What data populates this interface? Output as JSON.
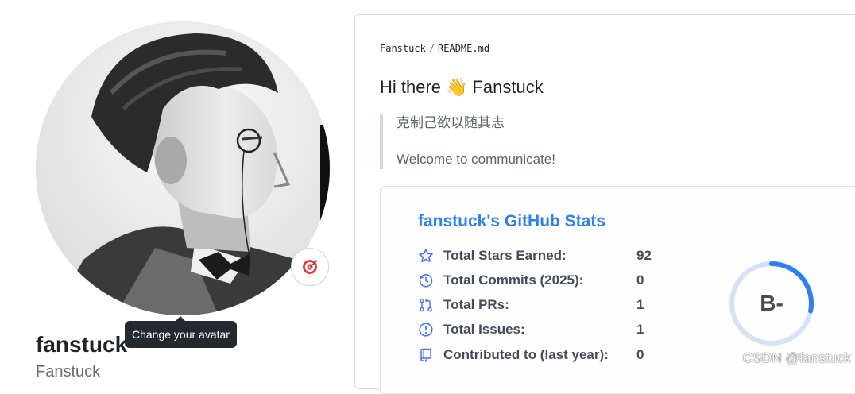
{
  "profile": {
    "name": "fanstuck",
    "login": "Fanstuck",
    "avatar_tooltip": "Change your avatar",
    "status_icon": "target-emoji-icon"
  },
  "readme": {
    "breadcrumb_user": "Fanstuck",
    "breadcrumb_sep": "/",
    "breadcrumb_file": "README.md",
    "greeting_prefix": "Hi there",
    "greeting_emoji": "👋",
    "greeting_name": "Fanstuck",
    "quote_line1": "克制己欲以随其志",
    "quote_line2": "Welcome to communicate!"
  },
  "stats": {
    "title": "fanstuck's GitHub Stats",
    "accent_color": "#2f80ed",
    "rows": [
      {
        "icon": "star-icon",
        "label": "Total Stars Earned:",
        "value": "92"
      },
      {
        "icon": "history-icon",
        "label": "Total Commits (2025):",
        "value": "0"
      },
      {
        "icon": "pull-request-icon",
        "label": "Total PRs:",
        "value": "1"
      },
      {
        "icon": "issue-icon",
        "label": "Total Issues:",
        "value": "1"
      },
      {
        "icon": "repo-icon",
        "label": "Contributed to (last year):",
        "value": "0"
      }
    ],
    "rank": "B-",
    "rank_progress": 0.28
  },
  "watermark": "CSDN @fanstuck"
}
